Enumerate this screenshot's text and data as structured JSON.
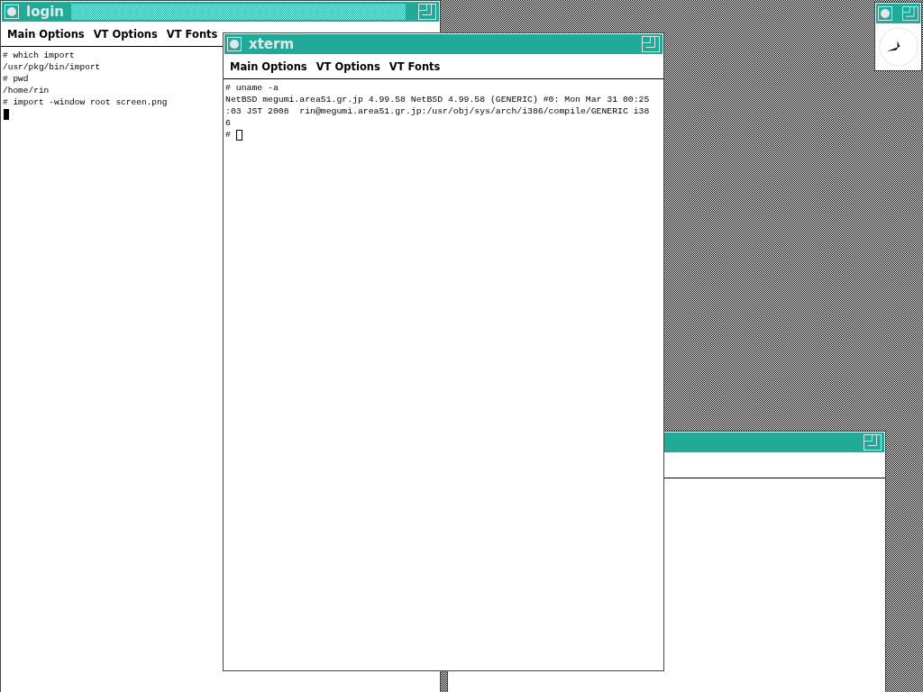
{
  "windows": [
    {
      "kind": "terminal",
      "title": "login",
      "hatched": true,
      "menu": [
        "Main Options",
        "VT Options",
        "VT Fonts"
      ],
      "lines": [
        "# which import",
        "/usr/pkg/bin/import",
        "# pwd",
        "/home/rin",
        "# import -window root screen.png"
      ],
      "focused": true
    },
    {
      "kind": "blank"
    },
    {
      "kind": "terminal",
      "title": "xterm",
      "hatched": false,
      "menu": [
        "Main Options",
        "VT Options",
        "VT Fonts"
      ],
      "lines": [
        "# uname -a",
        "NetBSD megumi.area51.gr.jp 4.99.58 NetBSD 4.99.58 (GENERIC) #0: Mon Mar 31 00:25",
        ":03 JST 2008  rin@megumi.area51.gr.jp:/usr/obj/sys/arch/i386/compile/GENERIC i38",
        "6"
      ],
      "prompt": "#",
      "focused": false
    },
    {
      "kind": "clock"
    }
  ]
}
